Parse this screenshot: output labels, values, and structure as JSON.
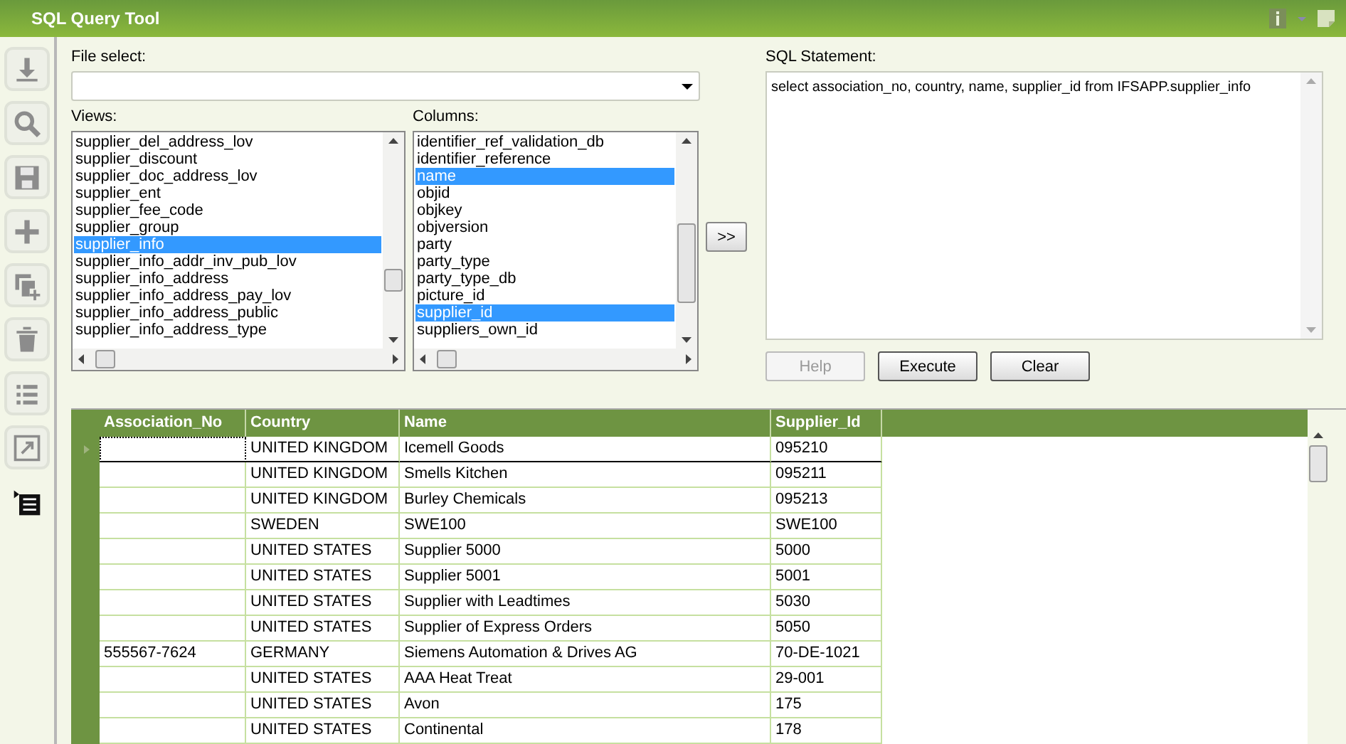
{
  "window": {
    "title": "SQL Query Tool"
  },
  "toolbar": [
    {
      "kind": "download",
      "selected": false
    },
    {
      "kind": "search",
      "selected": false
    },
    {
      "kind": "save",
      "selected": false
    },
    {
      "kind": "add",
      "selected": false
    },
    {
      "kind": "duplicate",
      "selected": false
    },
    {
      "kind": "delete",
      "selected": false
    },
    {
      "kind": "list",
      "selected": false
    },
    {
      "kind": "resize",
      "selected": false
    },
    {
      "kind": "outline",
      "selected": true
    }
  ],
  "file_select": {
    "label": "File select:"
  },
  "views": {
    "label": "Views:",
    "items": [
      {
        "text": "supplier_del_address_lov",
        "selected": false
      },
      {
        "text": "supplier_discount",
        "selected": false
      },
      {
        "text": "supplier_doc_address_lov",
        "selected": false
      },
      {
        "text": "supplier_ent",
        "selected": false
      },
      {
        "text": "supplier_fee_code",
        "selected": false
      },
      {
        "text": "supplier_group",
        "selected": false
      },
      {
        "text": "supplier_info",
        "selected": true
      },
      {
        "text": "supplier_info_addr_inv_pub_lov",
        "selected": false
      },
      {
        "text": "supplier_info_address",
        "selected": false
      },
      {
        "text": "supplier_info_address_pay_lov",
        "selected": false
      },
      {
        "text": "supplier_info_address_public",
        "selected": false
      },
      {
        "text": "supplier_info_address_type",
        "selected": false
      }
    ]
  },
  "columns": {
    "label": "Columns:",
    "items": [
      {
        "text": "identifier_ref_validation_db",
        "selected": false
      },
      {
        "text": "identifier_reference",
        "selected": false
      },
      {
        "text": "name",
        "selected": true
      },
      {
        "text": "objid",
        "selected": false
      },
      {
        "text": "objkey",
        "selected": false
      },
      {
        "text": "objversion",
        "selected": false
      },
      {
        "text": "party",
        "selected": false
      },
      {
        "text": "party_type",
        "selected": false
      },
      {
        "text": "party_type_db",
        "selected": false
      },
      {
        "text": "picture_id",
        "selected": false
      },
      {
        "text": "supplier_id",
        "selected": true
      },
      {
        "text": "suppliers_own_id",
        "selected": false
      }
    ]
  },
  "add_button": ">>",
  "sql_statement": {
    "label": "SQL Statement:",
    "value": "select association_no, country, name, supplier_id from IFSAPP.supplier_info"
  },
  "buttons": [
    {
      "label": "Help",
      "disabled": true
    },
    {
      "label": "Execute",
      "disabled": false
    },
    {
      "label": "Clear",
      "disabled": false
    }
  ],
  "table": {
    "columns": [
      "Association_No",
      "Country",
      "Name",
      "Supplier_Id"
    ],
    "rows": [
      {
        "current": true,
        "cells": [
          "",
          "UNITED KINGDOM",
          "Icemell Goods",
          "095210"
        ]
      },
      {
        "current": false,
        "cells": [
          "",
          "UNITED KINGDOM",
          "Smells Kitchen",
          "095211"
        ]
      },
      {
        "current": false,
        "cells": [
          "",
          "UNITED KINGDOM",
          "Burley Chemicals",
          "095213"
        ]
      },
      {
        "current": false,
        "cells": [
          "",
          "SWEDEN",
          "SWE100",
          "SWE100"
        ]
      },
      {
        "current": false,
        "cells": [
          "",
          "UNITED STATES",
          "Supplier 5000",
          "5000"
        ]
      },
      {
        "current": false,
        "cells": [
          "",
          "UNITED STATES",
          "Supplier 5001",
          "5001"
        ]
      },
      {
        "current": false,
        "cells": [
          "",
          "UNITED STATES",
          "Supplier with Leadtimes",
          "5030"
        ]
      },
      {
        "current": false,
        "cells": [
          "",
          "UNITED STATES",
          "Supplier of Express Orders",
          "5050"
        ]
      },
      {
        "current": false,
        "cells": [
          "555567-7624",
          "GERMANY",
          "Siemens Automation & Drives AG",
          "70-DE-1021"
        ]
      },
      {
        "current": false,
        "cells": [
          "",
          "UNITED STATES",
          "AAA Heat Treat",
          "29-001"
        ]
      },
      {
        "current": false,
        "cells": [
          "",
          "UNITED STATES",
          "Avon",
          "175"
        ]
      },
      {
        "current": false,
        "cells": [
          "",
          "UNITED STATES",
          "Continental",
          "178"
        ]
      }
    ]
  }
}
